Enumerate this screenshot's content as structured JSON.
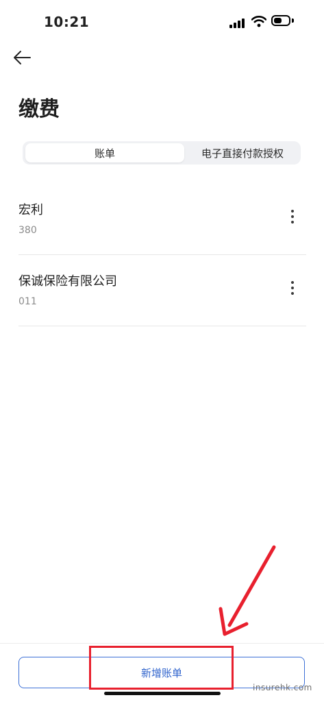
{
  "status_bar": {
    "time": "10:21"
  },
  "header": {
    "title": "缴费"
  },
  "tabs": [
    {
      "label": "账单",
      "active": true
    },
    {
      "label": "电子直接付款授权",
      "active": false
    }
  ],
  "bills": [
    {
      "name": "宏利",
      "number": "380"
    },
    {
      "name": "保诚保险有限公司",
      "number": "011"
    }
  ],
  "footer": {
    "add_button_label": "新增账单"
  },
  "annotation": {
    "highlight_color": "#e8202e"
  },
  "watermark": "insurehk.com",
  "colors": {
    "accent": "#3b6fd6",
    "annotation_red": "#e8202e"
  }
}
